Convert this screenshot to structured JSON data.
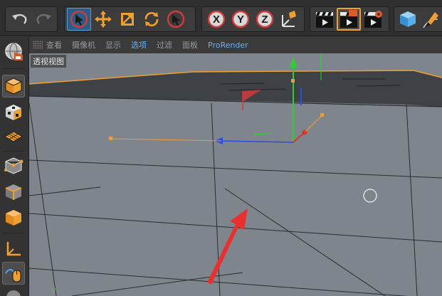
{
  "toolbar": {
    "undo_icon": "undo-icon",
    "redo_icon": "redo-icon",
    "x_label": "X",
    "y_label": "Y",
    "z_label": "Z"
  },
  "viewport_menu": {
    "items": [
      {
        "label": "查看"
      },
      {
        "label": "摄像机"
      },
      {
        "label": "显示"
      },
      {
        "label": "选项"
      },
      {
        "label": "过滤"
      },
      {
        "label": "面板"
      },
      {
        "label": "ProRender"
      }
    ]
  },
  "viewport": {
    "label": "透视视图",
    "axis_y": "Y"
  },
  "colors": {
    "active_blue": "#2a5d88",
    "highlight_menu": "#5fb3ff",
    "axis_x": "#e0302a",
    "axis_y": "#2bd12b",
    "axis_z": "#2b4ee0",
    "handle_orange": "#f0a030"
  }
}
